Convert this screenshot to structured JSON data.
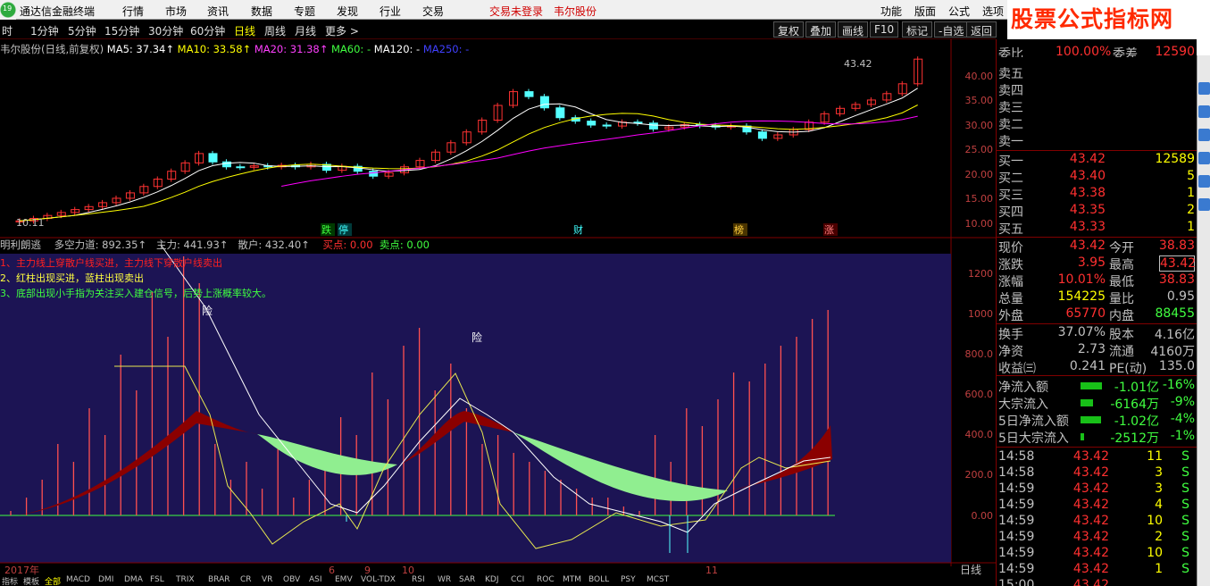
{
  "menu": {
    "app_title": "通达信金融终端",
    "items": [
      "行情",
      "市场",
      "资讯",
      "数据",
      "专题",
      "发现",
      "行业",
      "交易"
    ],
    "trade_status": "交易未登录",
    "stock_name": "韦尔股份",
    "right_items": [
      "功能",
      "版面",
      "公式",
      "选项"
    ],
    "logo_badge": "19"
  },
  "ad": {
    "title": "股票公式指标网",
    "url": "www.gszx.com.cn"
  },
  "periods": [
    "时",
    "1分钟",
    "5分钟",
    "15分钟",
    "30分钟",
    "60分钟",
    "日线",
    "周线",
    "月线",
    "更多 >"
  ],
  "active_period": "日线",
  "toolbar": [
    "复权",
    "叠加",
    "画线",
    "F10",
    "标记",
    "-自选",
    "返回"
  ],
  "main_chart": {
    "title": "韦尔股份(日线,前复权)",
    "ma5": "MA5: 37.34↑",
    "ma10": "MA10: 33.58↑",
    "ma20": "MA20: 31.38↑",
    "ma60": "MA60: -",
    "ma120": "MA120: -",
    "ma250": "MA250: -",
    "high_label": "43.42",
    "low_label": "10.11",
    "yaxis": [
      "40.00",
      "35.00",
      "30.00",
      "25.00",
      "20.00",
      "15.00",
      "10.00"
    ],
    "event_tags": [
      "跌",
      "停",
      "财",
      "榜",
      "涨"
    ]
  },
  "indicator": {
    "name": "明利朗逃",
    "duokong": "多空力道: 892.35↑",
    "zhuli": "主力: 441.93↑",
    "sanhu": "散户: 432.40↑",
    "buy": "买点: 0.00",
    "sell": "卖点: 0.00",
    "notes": [
      "1、主力线上穿散户线买进，主力线下穿散户线卖出",
      "2、红柱出现买进，蓝柱出现卖出",
      "3、底部出现小手指为关注买入建仓信号，后势上涨概率较大。"
    ],
    "risk_label": "险",
    "yaxis": [
      "1200",
      "1000",
      "800.0",
      "600.0",
      "400.0",
      "200.0",
      "0.00"
    ]
  },
  "xaxis": {
    "year_label": "2017年",
    "month_labels": [
      "6",
      "9",
      "10",
      "11"
    ],
    "period_label": "日线"
  },
  "quote": {
    "header_label": "委比",
    "header_value": "100.00%",
    "header_label2": "委差",
    "header_value2": "12590",
    "sell_levels": [
      "卖五",
      "卖四",
      "卖三",
      "卖二",
      "卖一"
    ],
    "buy_levels": [
      {
        "label": "买一",
        "price": "43.42",
        "vol": "12589"
      },
      {
        "label": "买二",
        "price": "43.40",
        "vol": "5"
      },
      {
        "label": "买三",
        "price": "43.38",
        "vol": "1"
      },
      {
        "label": "买四",
        "price": "43.35",
        "vol": "2"
      },
      {
        "label": "买五",
        "price": "43.33",
        "vol": "1"
      }
    ],
    "stats": [
      {
        "l1": "现价",
        "v1": "43.42",
        "l2": "今开",
        "v2": "38.83"
      },
      {
        "l1": "涨跌",
        "v1": "3.95",
        "l2": "最高",
        "v2": "43.42"
      },
      {
        "l1": "涨幅",
        "v1": "10.01%",
        "l2": "最低",
        "v2": "38.83"
      },
      {
        "l1": "总量",
        "v1": "154225",
        "l2": "量比",
        "v2": "0.95"
      },
      {
        "l1": "外盘",
        "v1": "65770",
        "l2": "内盘",
        "v2": "88455"
      }
    ],
    "fundamentals": [
      {
        "l1": "换手",
        "v1": "37.07%",
        "l2": "股本",
        "v2": "4.16亿"
      },
      {
        "l1": "净资",
        "v1": "2.73",
        "l2": "流通",
        "v2": "4160万"
      },
      {
        "l1": "收益㈢",
        "v1": "0.241",
        "l2": "PE(动)",
        "v2": "135.0"
      }
    ],
    "flows": [
      {
        "label": "净流入额",
        "value": "-1.01亿",
        "pct": "-16%",
        "bar": 0.8
      },
      {
        "label": "大宗流入",
        "value": "-6164万",
        "pct": "-9%",
        "bar": 0.45
      },
      {
        "label": "5日净流入额",
        "value": "-1.02亿",
        "pct": "-4%",
        "bar": 0.75
      },
      {
        "label": "5日大宗流入",
        "value": "-2512万",
        "pct": "-1%",
        "bar": 0.12
      }
    ],
    "ticks": [
      {
        "time": "14:58",
        "price": "43.42",
        "vol": "11",
        "side": "S"
      },
      {
        "time": "14:58",
        "price": "43.42",
        "vol": "3",
        "side": "S"
      },
      {
        "time": "14:59",
        "price": "43.42",
        "vol": "3",
        "side": "S"
      },
      {
        "time": "14:59",
        "price": "43.42",
        "vol": "4",
        "side": "S"
      },
      {
        "time": "14:59",
        "price": "43.42",
        "vol": "10",
        "side": "S"
      },
      {
        "time": "14:59",
        "price": "43.42",
        "vol": "2",
        "side": "S"
      },
      {
        "time": "14:59",
        "price": "43.42",
        "vol": "10",
        "side": "S"
      },
      {
        "time": "14:59",
        "price": "43.42",
        "vol": "1",
        "side": "S"
      },
      {
        "time": "15:00",
        "price": "43.42",
        "vol": "",
        "side": ""
      }
    ]
  },
  "bottom_tabs": [
    "指标",
    "模板",
    "全部",
    "MACD",
    "DMI",
    "DMA",
    "FSL",
    "TRIX",
    "BRAR",
    "CR",
    "VR",
    "OBV",
    "ASI",
    "EMV",
    "VOL-TDX",
    "RSI",
    "WR",
    "SAR",
    "KDJ",
    "CCI",
    "ROC",
    "MTM",
    "BOLL",
    "PSY",
    "MCST"
  ],
  "active_tab": "全部",
  "colors": {
    "up": "#ff3232",
    "down": "#54ffff",
    "ma5": "#ffffff",
    "ma10": "#ffff00",
    "ma20": "#ff00ff",
    "ma60": "#00ff00",
    "indicator_bg": "#1c1454",
    "red_band": "#8b0000",
    "green_band": "#90ee90"
  }
}
